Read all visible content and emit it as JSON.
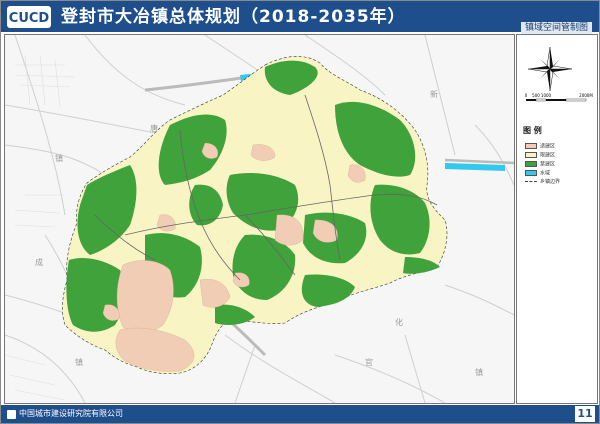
{
  "header": {
    "title": "登封市大冶镇总体规划（2018-2035年）",
    "subtitle": "镇域空间管制图",
    "logo_text": "CUCD"
  },
  "colors": {
    "header_blue": "#1e4f8c",
    "built": "#f0cdb4",
    "limited": "#f8f4c4",
    "forbidden": "#3fa23a",
    "water": "#33c8ee"
  },
  "scale_bar": {
    "labels": [
      "0",
      "500",
      "1000",
      "2000M"
    ]
  },
  "legend": {
    "title": "图 例",
    "items": [
      {
        "label": "适建区",
        "icon": "built-area-swatch"
      },
      {
        "label": "限建区",
        "icon": "limited-area-swatch"
      },
      {
        "label": "禁建区",
        "icon": "forbidden-area-swatch"
      },
      {
        "label": "水域",
        "icon": "water-swatch"
      },
      {
        "label": "乡镇边界",
        "icon": "boundary-line-swatch"
      }
    ]
  },
  "map_labels": {
    "town_1": "镇",
    "town_2": "镇",
    "town_3": "镇",
    "place_1": "成",
    "place_2": "化",
    "place_3": "官",
    "place_4": "唐",
    "place_5": "新"
  },
  "footer": {
    "org": "中国城市建设研究院有限公司",
    "page": "11"
  }
}
